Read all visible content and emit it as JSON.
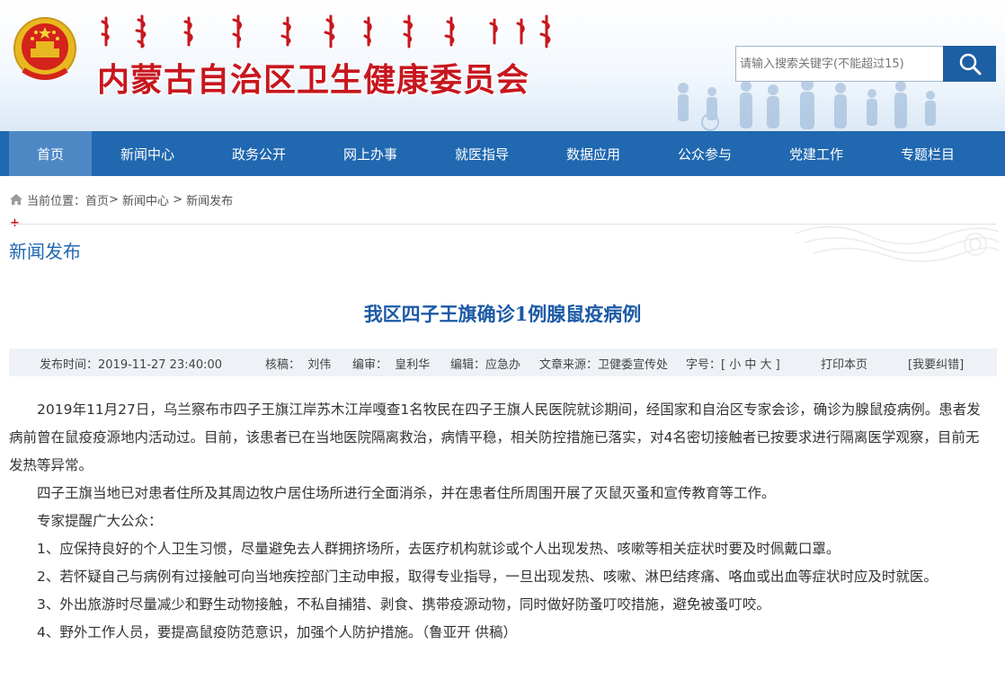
{
  "header": {
    "mongolian_title": "ᠦᠪᠦᠷ ᠮᠣᠩᠭᠣᠯ ᠤᠨ ᠥᠪᠡᠷᠲᠡᠭᠡᠨ ᠵᠠᠰᠠᠬᠤ ᠣᠷᠣᠨ ᠤ ᠡᠷᠡᠭᠦᠯ ᠮᠡᠨᠳᠦ",
    "site_title": "内蒙古自治区卫生健康委员会",
    "search_placeholder": "请输入搜索关键字(不能超过15)",
    "search_icon": "search-icon",
    "emblem_icon": "national-emblem-icon"
  },
  "nav": {
    "items": [
      {
        "label": "首页"
      },
      {
        "label": "新闻中心"
      },
      {
        "label": "政务公开"
      },
      {
        "label": "网上办事"
      },
      {
        "label": "就医指导"
      },
      {
        "label": "数据应用"
      },
      {
        "label": "公众参与"
      },
      {
        "label": "党建工作"
      },
      {
        "label": "专题栏目"
      }
    ]
  },
  "breadcrumb": {
    "prefix": "当前位置：",
    "items": [
      {
        "label": "首页"
      },
      {
        "label": "新闻中心"
      },
      {
        "label": "新闻发布"
      }
    ],
    "sep1": ">",
    "sep2": " > "
  },
  "section": {
    "plus": "+",
    "title": "新闻发布"
  },
  "article": {
    "title": "我区四子王旗确诊1例腺鼠疫病例",
    "meta": {
      "publish_time": "发布时间：2019-11-27 23:40:00",
      "reviewer": "核稿：  刘伟",
      "editor": "编审：  皇利华",
      "compiler": "编辑：应急办",
      "source": "文章来源：卫健委宣传处",
      "font_size": "字号：[ 小 中 大 ]",
      "print": "打印本页",
      "report_error": "[我要纠错]"
    },
    "paragraphs": [
      "2019年11月27日，乌兰察布市四子王旗江岸苏木江岸嘎查1名牧民在四子王旗人民医院就诊期间，经国家和自治区专家会诊，确诊为腺鼠疫病例。患者发病前曾在鼠疫疫源地内活动过。目前，该患者已在当地医院隔离救治，病情平稳，相关防控措施已落实，对4名密切接触者已按要求进行隔离医学观察，目前无发热等异常。",
      "四子王旗当地已对患者住所及其周边牧户居住场所进行全面消杀，并在患者住所周围开展了灭鼠灭蚤和宣传教育等工作。",
      "专家提醒广大公众：",
      "1、应保持良好的个人卫生习惯，尽量避免去人群拥挤场所，去医疗机构就诊或个人出现发热、咳嗽等相关症状时要及时佩戴口罩。",
      "2、若怀疑自己与病例有过接触可向当地疾控部门主动申报，取得专业指导，一旦出现发热、咳嗽、淋巴结疼痛、咯血或出血等症状时应及时就医。",
      "3、外出旅游时尽量减少和野生动物接触，不私自捕猎、剥食、携带疫源动物，同时做好防蚤叮咬措施，避免被蚤叮咬。",
      "4、野外工作人员，要提高鼠疫防范意识，加强个人防护措施。（鲁亚开  供稿）"
    ]
  },
  "colors": {
    "brand_blue": "#2068b0",
    "nav_active": "#4d88c5",
    "title_red": "#c8161d",
    "article_title_blue": "#1c5aa6"
  }
}
